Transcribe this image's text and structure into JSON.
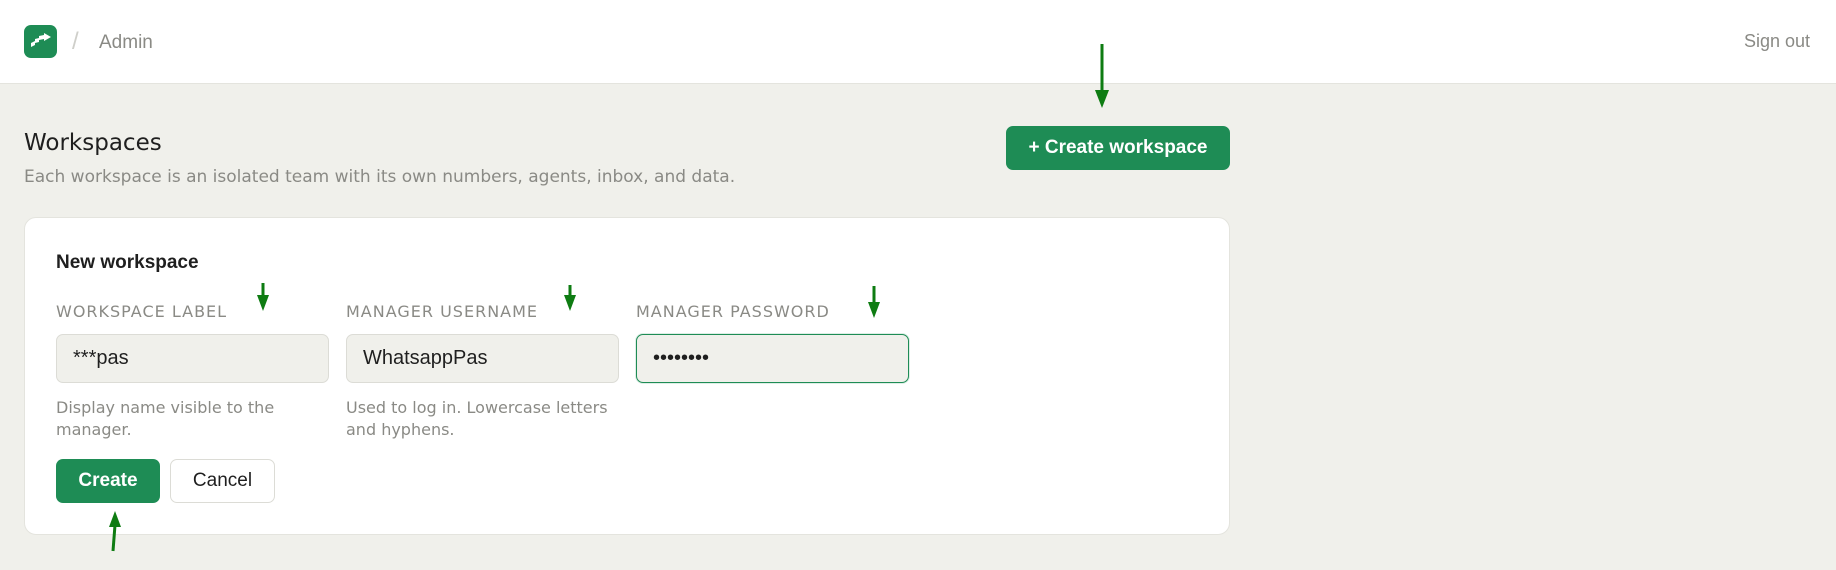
{
  "header": {
    "breadcrumb_separator": "/",
    "breadcrumb": "Admin",
    "signout_label": "Sign out",
    "logo_icon": "chart-steps-logo-icon"
  },
  "page": {
    "title": "Workspaces",
    "subtitle": "Each workspace is an isolated team with its own numbers, agents, inbox, and data.",
    "create_workspace_label": "+ Create workspace"
  },
  "form": {
    "title": "New workspace",
    "fields": [
      {
        "label": "WORKSPACE LABEL",
        "value": "***pas",
        "help": "Display name visible to the manager.",
        "type": "text"
      },
      {
        "label": "MANAGER USERNAME",
        "value": "WhatsappPas",
        "help": "Used to log in. Lowercase letters and hyphens.",
        "type": "text"
      },
      {
        "label": "MANAGER PASSWORD",
        "value": "password",
        "help": "",
        "type": "password"
      }
    ],
    "create_label": "Create",
    "cancel_label": "Cancel"
  },
  "annotations": {
    "arrow_color": "#0e7c12",
    "arrow_icon": "green-annotation-arrow-icon"
  },
  "colors": {
    "accent": "#1e8c55",
    "background": "#f0f0eb",
    "muted_text": "#8a8a85"
  }
}
